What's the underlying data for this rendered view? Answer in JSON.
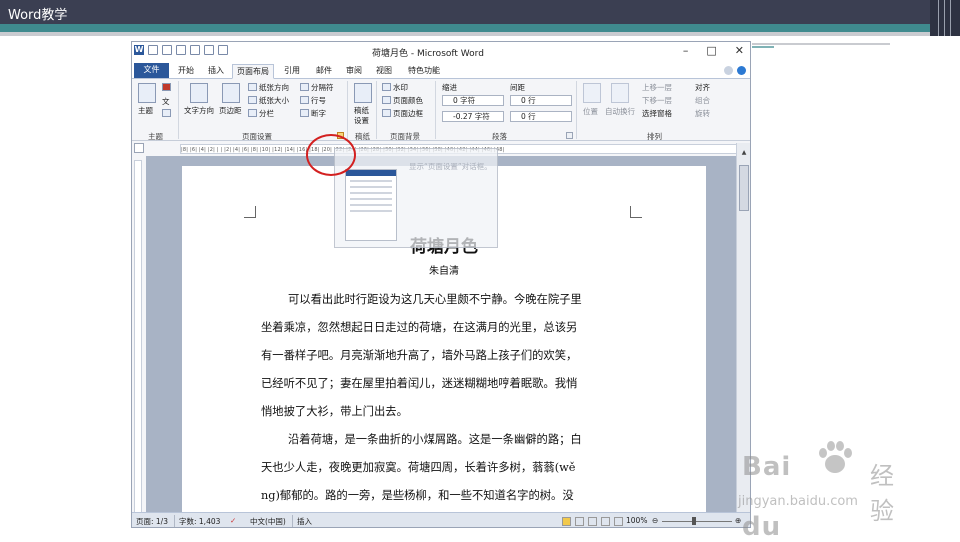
{
  "slide": {
    "title": "Word教学"
  },
  "window": {
    "title": "荷塘月色 - Microsoft Word",
    "logo": "W",
    "controls": [
      "–",
      "□",
      "✕"
    ]
  },
  "tabs": [
    "文件",
    "开始",
    "插入",
    "页面布局",
    "引用",
    "邮件",
    "审阅",
    "视图",
    "特色功能"
  ],
  "active_tab": "页面布局",
  "ribbon": {
    "theme_group": {
      "label": "主题",
      "theme_btn": "主题",
      "items": [
        "文",
        "文"
      ]
    },
    "page_setup": {
      "label": "页面设置",
      "text_direction": "文字方向",
      "margins": "页边距",
      "orientation": "纸张方向",
      "size": "纸张大小",
      "columns": "分栏",
      "breaks": "分隔符",
      "line_numbers": "行号",
      "hyphenation": "断字"
    },
    "draft": {
      "label": "稿纸",
      "btn1": "稿纸",
      "btn2": "设置"
    },
    "page_background": {
      "label": "页面背景",
      "watermark": "水印",
      "page_color": "页面颜色",
      "page_borders": "页面边框"
    },
    "paragraph": {
      "label": "段落",
      "indent_title": "缩进",
      "spacing_title": "间距",
      "indent_left": "0 字符",
      "indent_right": "-0.27 字符",
      "spacing_before": "0 行",
      "spacing_after": "0 行"
    },
    "arrange": {
      "label": "排列",
      "position": "位置",
      "wrap": "自动换行",
      "bring_forward": "上移一层",
      "send_backward": "下移一层",
      "selection_pane": "选择窗格",
      "align": "对齐",
      "group": "组合",
      "rotate": "旋转"
    }
  },
  "ruler_ticks": "|8| |6| |4| |2| | | |2| |4| |6| |8| |10| |12| |14| |16| |18| |20| |22| |24| |26| |28| |30| |32| |34| |36| |38| |40| |42| |44| |46| |48|",
  "tooltip": {
    "text": "显示“页面设置”对话框。"
  },
  "document": {
    "heading": "荷塘月色",
    "author": "朱自清",
    "lines": [
      {
        "text": "可以看出此时行距设为这几天心里颇不宁静。今晚在院子里",
        "indent": true
      },
      {
        "text": "坐着乘凉，忽然想起日日走过的荷塘，在这满月的光里，总该另",
        "indent": false
      },
      {
        "text": "有一番样子吧。月亮渐渐地升高了，墙外马路上孩子们的欢笑，",
        "indent": false
      },
      {
        "text": "已经听不见了；妻在屋里拍着闰儿，迷迷糊糊地哼着眠歌。我悄",
        "indent": false
      },
      {
        "text": "悄地披了大衫，带上门出去。",
        "indent": false
      },
      {
        "text": "沿着荷塘，是一条曲折的小煤屑路。这是一条幽僻的路；白",
        "indent": true
      },
      {
        "text": "天也少人走，夜晚更加寂寞。荷塘四周，长着许多树，蓊蓊(wě",
        "indent": false
      },
      {
        "text": "ng)郁郁的。路的一旁，是些杨柳，和一些不知道名字的树。没",
        "indent": false
      }
    ]
  },
  "status": {
    "page": "页面: 1/3",
    "words": "字数: 1,403",
    "language": "中文(中国)",
    "mode": "插入",
    "zoom": "100%",
    "zoom_level": 1.0
  },
  "watermark": {
    "brand": "Bai",
    "brand2": "du",
    "cn": "经验",
    "url": "jingyan.baidu.com"
  },
  "colors": {
    "file_tab": "#2b579a",
    "slide_bar": "#3b3f52",
    "slide_teal": "#3f8a8e",
    "highlight_circle": "#d32020"
  }
}
